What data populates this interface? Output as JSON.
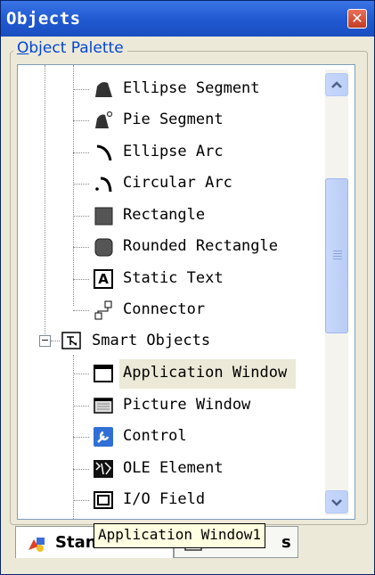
{
  "window": {
    "title": "Objects",
    "close_glyph": "✕"
  },
  "palette": {
    "group_label_first": "O",
    "group_label_rest": "bject Palette",
    "items": [
      {
        "label": "Ellipse Segment",
        "icon": "ellipse-segment-icon"
      },
      {
        "label": "Pie Segment",
        "icon": "pie-segment-icon"
      },
      {
        "label": "Ellipse Arc",
        "icon": "ellipse-arc-icon"
      },
      {
        "label": "Circular Arc",
        "icon": "circular-arc-icon"
      },
      {
        "label": "Rectangle",
        "icon": "rectangle-icon"
      },
      {
        "label": "Rounded Rectangle",
        "icon": "rounded-rectangle-icon"
      },
      {
        "label": "Static Text",
        "icon": "static-text-icon"
      },
      {
        "label": "Connector",
        "icon": "connector-icon"
      }
    ],
    "group_node": {
      "label": "Smart Objects",
      "expander": "−",
      "icon": "smart-objects-icon"
    },
    "smart_items": [
      {
        "label": "Application Window",
        "icon": "application-window-icon",
        "selected": true
      },
      {
        "label": "Picture Window",
        "icon": "picture-window-icon"
      },
      {
        "label": "Control",
        "icon": "control-icon"
      },
      {
        "label": "OLE Element",
        "icon": "ole-element-icon"
      },
      {
        "label": "I/O Field",
        "icon": "io-field-icon"
      }
    ],
    "static_text_glyph": "A"
  },
  "tabs": {
    "standard": "Standard",
    "second": "s"
  },
  "tooltip": "Application Window1",
  "colors": {
    "titlebar": "#2460d8",
    "selection": "#ece9d8",
    "link": "#0046d5"
  }
}
